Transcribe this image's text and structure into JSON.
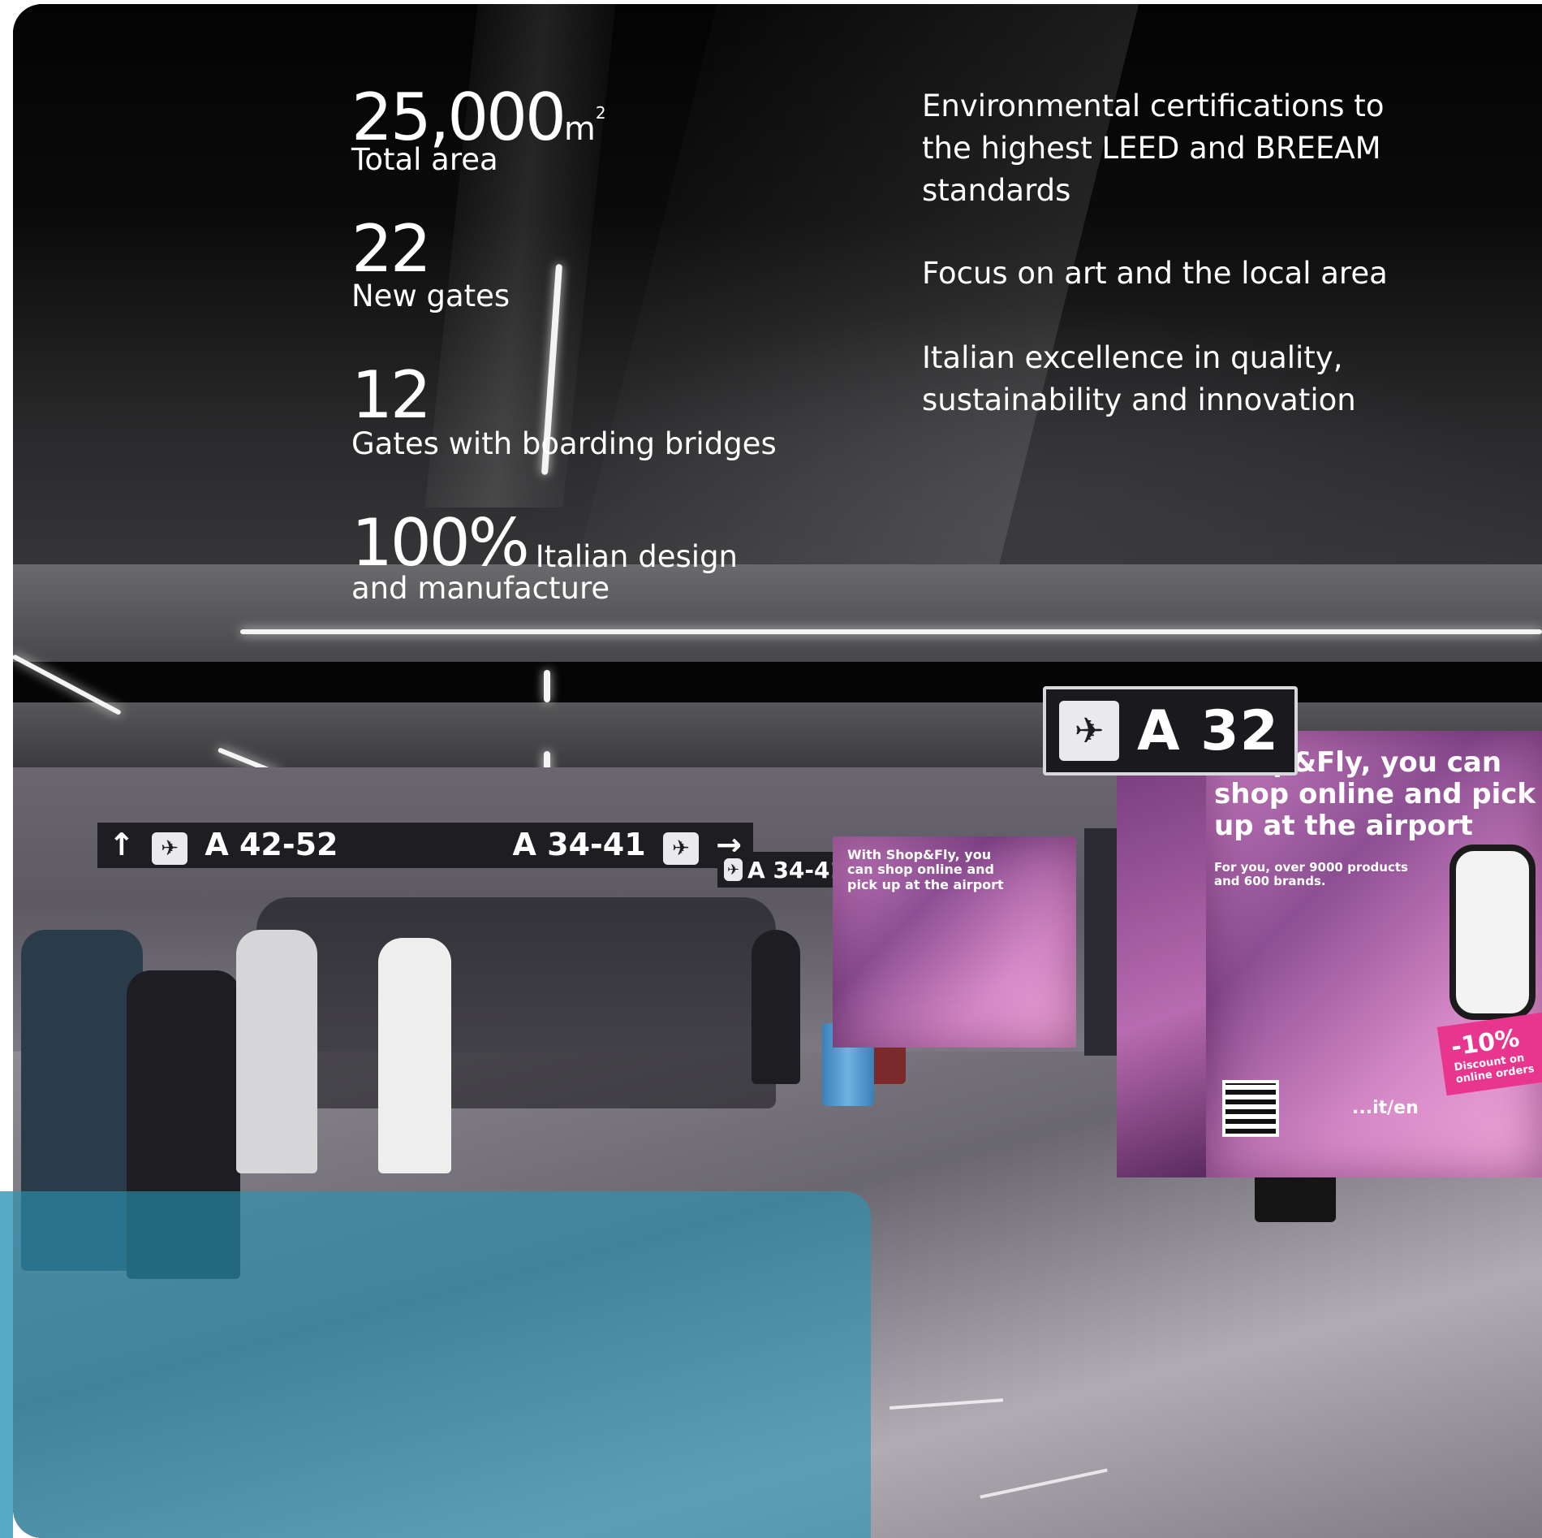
{
  "stats": [
    {
      "value": "25,000",
      "unit": "m",
      "sup": "2",
      "label": "Total area"
    },
    {
      "value": "22",
      "label": "New gates"
    },
    {
      "value": "12",
      "label": "Gates with boarding bridges"
    },
    {
      "value": "100%",
      "label_inline": "Italian design",
      "label": "and manufacture"
    }
  ],
  "features": [
    "Environmental certifications to the highest LEED and BREEAM standards",
    "Focus on art and the local area",
    "Italian excellence in quality, sustainability and innovation"
  ],
  "photo": {
    "signs": {
      "left": "A 42-52",
      "right": "A 34-41",
      "side": "A 34-41",
      "big": "A 32"
    },
    "ad_headline": "Shop&Fly, you can shop online and pick up at the airport",
    "ad_sub": "For you, over 9000 products and 600 brands.",
    "ad_small_headline": "With Shop&Fly, you can shop online and pick up at the airport",
    "ad_discount": "-10%",
    "ad_discount_sub": "Discount on online orders",
    "ad_url": "...it/en"
  },
  "colors": {
    "overlay_teal": "#2896b4",
    "ad_pink": "#e8368f"
  }
}
